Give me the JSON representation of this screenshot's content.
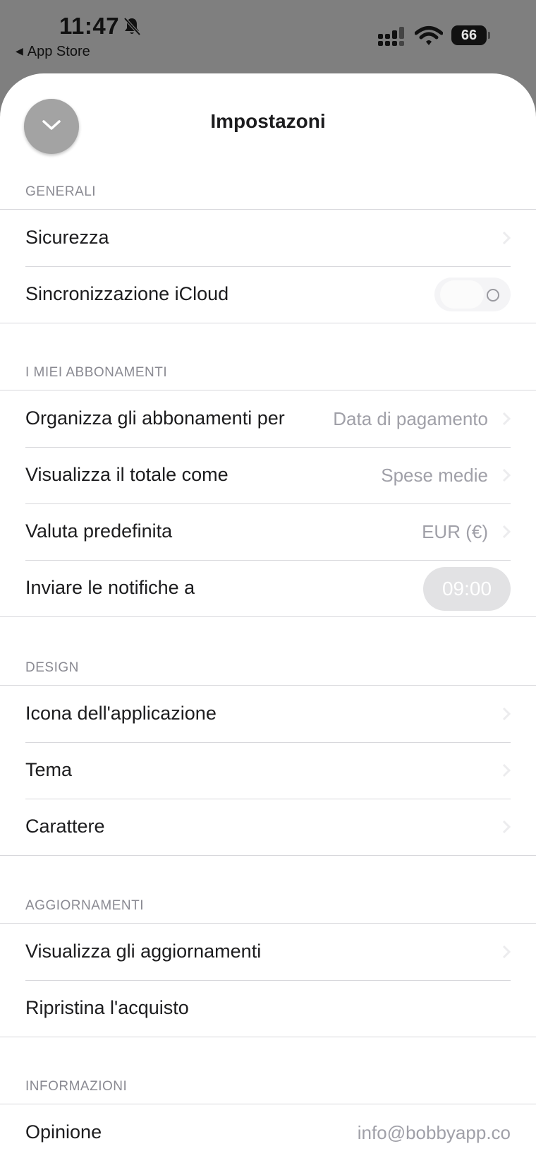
{
  "status_bar": {
    "time": "11:47",
    "back_label": "App Store",
    "battery": "66",
    "icons": [
      "bell-slash-icon",
      "cellular-signal-icon",
      "wifi-icon",
      "battery-icon"
    ]
  },
  "header": {
    "title": "Impostazoni",
    "close_icon": "chevron-down-icon"
  },
  "sections": {
    "generali": {
      "title": "GENERALI",
      "rows": [
        {
          "label": "Sicurezza"
        },
        {
          "label": "Sincronizzazione iCloud",
          "toggle_on": false
        }
      ]
    },
    "abbonamenti": {
      "title": "I MIEI ABBONAMENTI",
      "rows": [
        {
          "label": "Organizza gli abbonamenti per",
          "value": "Data di pagamento"
        },
        {
          "label": "Visualizza il totale come",
          "value": "Spese medie"
        },
        {
          "label": "Valuta predefinita",
          "value": "EUR (€)"
        },
        {
          "label": "Inviare le notifiche a",
          "value": "09:00"
        }
      ]
    },
    "design": {
      "title": "DESIGN",
      "rows": [
        {
          "label": "Icona dell'applicazione"
        },
        {
          "label": "Tema"
        },
        {
          "label": "Carattere"
        }
      ]
    },
    "aggiornamenti": {
      "title": "AGGIORNAMENTI",
      "rows": [
        {
          "label": "Visualizza gli aggiornamenti"
        },
        {
          "label": "Ripristina l'acquisto"
        }
      ]
    },
    "informazioni": {
      "title": "INFORMAZIONI",
      "rows": [
        {
          "label": "Opinione",
          "value": "info@bobbyapp.co"
        }
      ]
    }
  },
  "colors": {
    "backdrop": "#7f7f7f",
    "sheet": "#ffffff",
    "label": "#1c1c1e",
    "secondary": "#a0a0a8",
    "section_header": "#8a8a92",
    "separator": "#d8d8dc"
  }
}
